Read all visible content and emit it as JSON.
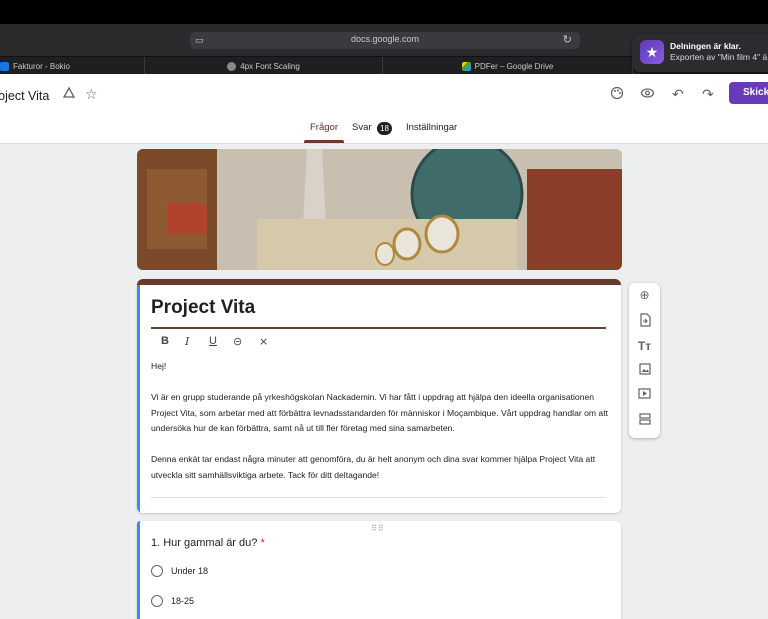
{
  "browser": {
    "url": "docs.google.com",
    "tabs": [
      {
        "label": "Fakturor - Bokio",
        "color": "#1a73e8"
      },
      {
        "label": "4px Font Scaling",
        "color": "#888888"
      },
      {
        "label": "PDFer – Google Drive",
        "color": "#34a853"
      }
    ]
  },
  "notification": {
    "title": "Delningen är klar.",
    "body": "Exporten av \"Min film 4\" ä"
  },
  "header": {
    "doc_title": "roject Vita",
    "send_label": "Skicka",
    "tabs": [
      {
        "label": "Frågor"
      },
      {
        "label": "Svar"
      },
      {
        "label": "Inställningar"
      }
    ],
    "responses_count": "18",
    "accent_color": "#673ab7"
  },
  "form": {
    "title": "Project Vita",
    "description": [
      "Hej!",
      "",
      "Vi är en grupp studerande på yrkeshögskolan Nackademin. Vi har fått i uppdrag att hjälpa den ideella organisationen Project Vita, som arbetar med att förbättra levnadsstandarden för människor i Moçambique. Vårt uppdrag handlar om att undersöka hur de kan förbättra, samt nå ut till fler företag med sina samarbeten.",
      "",
      "Denna enkät tar endast några minuter att genomföra, du är helt anonym och dina svar kommer hjälpa Project Vita att utveckla sitt samhällsviktiga arbete. Tack för ditt deltagande!"
    ],
    "theme_color": "#6b3a2e"
  },
  "question1": {
    "title": "1. Hur gammal är du?",
    "required_mark": "*",
    "options": [
      "Under 18",
      "18-25"
    ]
  },
  "icons": {
    "header": [
      "palette-icon",
      "preview-eye-icon",
      "undo-icon",
      "redo-icon",
      "add-collaborator-icon",
      "star-icon"
    ],
    "sidebar": [
      "add-question-icon",
      "import-questions-icon",
      "add-title-icon",
      "add-image-icon",
      "add-video-icon",
      "add-section-icon"
    ],
    "format": [
      "bold-icon",
      "italic-icon",
      "underline-icon",
      "link-icon",
      "clear-format-icon"
    ]
  }
}
